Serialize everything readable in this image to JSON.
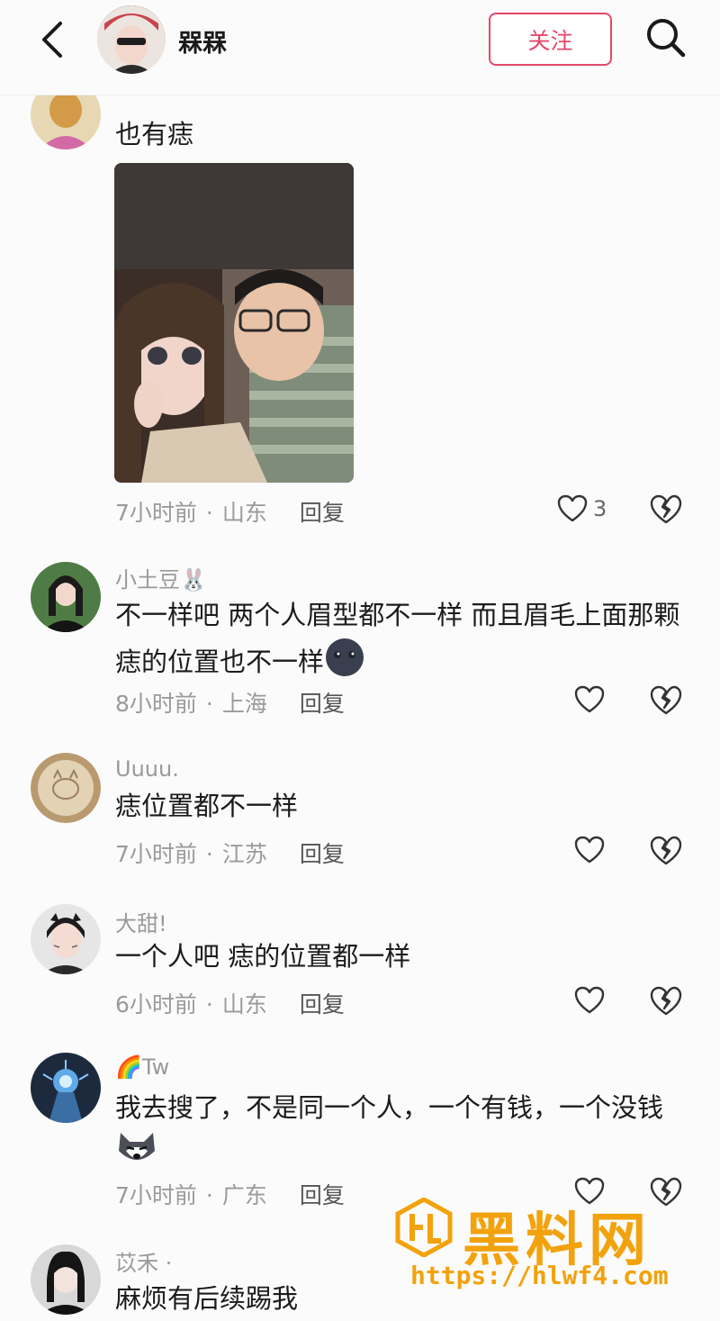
{
  "header": {
    "title": "槑槑",
    "follow_label": "关注"
  },
  "comments": [
    {
      "name": "",
      "text": "也有痣",
      "time": "7小时前",
      "location": "山东",
      "reply": "回复",
      "likes": "3",
      "has_photo": true
    },
    {
      "name": "小土豆🐰",
      "text": "不一样吧 两个人眉型都不一样 而且眉毛上面那颗痣的位置也不一样",
      "time": "8小时前",
      "location": "上海",
      "reply": "回复",
      "likes": ""
    },
    {
      "name": "Uuuu.",
      "text": "痣位置都不一样",
      "time": "7小时前",
      "location": "江苏",
      "reply": "回复",
      "likes": ""
    },
    {
      "name": "大甜!",
      "text": "一个人吧  痣的位置都一样",
      "time": "6小时前",
      "location": "山东",
      "reply": "回复",
      "likes": ""
    },
    {
      "name": "🌈Tw",
      "text": "我去搜了，不是同一个人，一个有钱，一个没钱",
      "time": "7小时前",
      "location": "广东",
      "reply": "回复",
      "likes": ""
    },
    {
      "name": "苡禾 ·",
      "text": "麻烦有后续踢我",
      "time": "",
      "location": "",
      "reply": "",
      "likes": ""
    }
  ],
  "watermark": {
    "title": "黑料网",
    "url": "https://hlwf4.com"
  },
  "colors": {
    "accent": "#e5486a",
    "meta_text": "#9a9a9a",
    "watermark": "#f2a20c"
  },
  "icons": [
    "back-arrow-icon",
    "search-icon",
    "heart-icon",
    "broken-heart-icon"
  ]
}
